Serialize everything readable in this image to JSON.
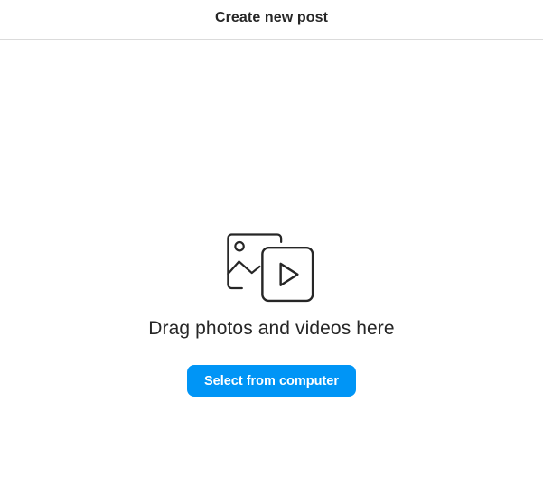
{
  "header": {
    "title": "Create new post"
  },
  "upload": {
    "icon": "photo-video-icon",
    "prompt": "Drag photos and videos here",
    "button_label": "Select from computer",
    "button_color": "#0095f6"
  }
}
